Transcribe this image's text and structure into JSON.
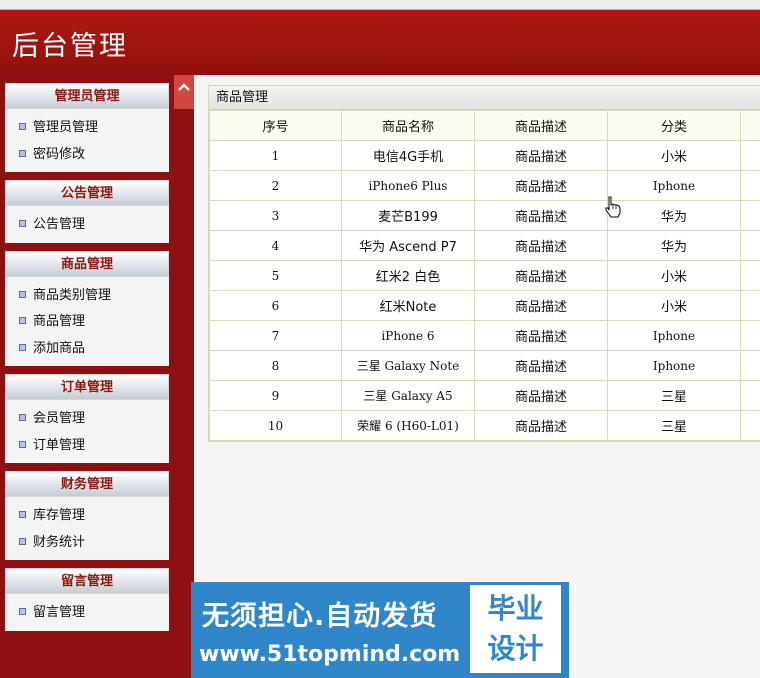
{
  "header": {
    "title": "后台管理"
  },
  "sidebar": {
    "groups": [
      {
        "title": "管理员管理",
        "items": [
          "管理员管理",
          "密码修改"
        ]
      },
      {
        "title": "公告管理",
        "items": [
          "公告管理"
        ]
      },
      {
        "title": "商品管理",
        "items": [
          "商品类别管理",
          "商品管理",
          "添加商品"
        ]
      },
      {
        "title": "订单管理",
        "items": [
          "会员管理",
          "订单管理"
        ]
      },
      {
        "title": "财务管理",
        "items": [
          "库存管理",
          "财务统计"
        ]
      },
      {
        "title": "留言管理",
        "items": [
          "留言管理"
        ]
      }
    ]
  },
  "panel": {
    "title": "商品管理",
    "columns": [
      "序号",
      "商品名称",
      "商品描述",
      "分类"
    ],
    "rows": [
      {
        "id": "1",
        "name": "电信4G手机",
        "desc": "商品描述",
        "category": "小米"
      },
      {
        "id": "2",
        "name": "iPhone6 Plus",
        "desc": "商品描述",
        "category": "Iphone"
      },
      {
        "id": "3",
        "name": "麦芒B199",
        "desc": "商品描述",
        "category": "华为"
      },
      {
        "id": "4",
        "name": "华为 Ascend P7",
        "desc": "商品描述",
        "category": "华为"
      },
      {
        "id": "5",
        "name": "红米2 白色",
        "desc": "商品描述",
        "category": "小米"
      },
      {
        "id": "6",
        "name": "红米Note",
        "desc": "商品描述",
        "category": "小米"
      },
      {
        "id": "7",
        "name": "iPhone 6",
        "desc": "商品描述",
        "category": "Iphone"
      },
      {
        "id": "8",
        "name": "三星 Galaxy Note",
        "desc": "商品描述",
        "category": "Iphone"
      },
      {
        "id": "9",
        "name": "三星 Galaxy A5",
        "desc": "商品描述",
        "category": "三星"
      },
      {
        "id": "10",
        "name": "荣耀 6 (H60-L01)",
        "desc": "商品描述",
        "category": "三星"
      }
    ]
  },
  "watermark": {
    "line1": "无须担心.自动发货",
    "line2": "www.51topmind.com",
    "badge_line1": "毕业",
    "badge_line2": "设计"
  },
  "colors": {
    "header_red": "#9b1410",
    "menu_title": "#8b1a10",
    "watermark_blue": "#2f86c8"
  },
  "icons": {
    "collapse": "chevron-up-icon",
    "bullet": "square-bullet-icon",
    "cursor": "hand-pointer-icon"
  }
}
